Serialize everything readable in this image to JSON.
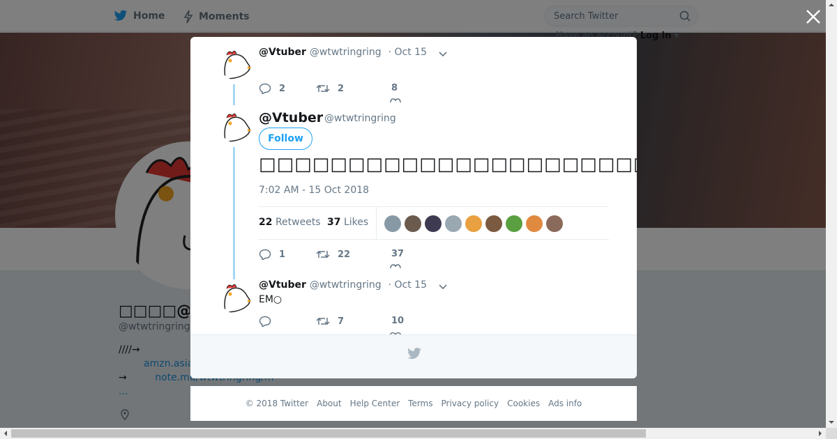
{
  "nav": {
    "home": "Home",
    "moments": "Moments"
  },
  "search": {
    "placeholder": "Search Twitter"
  },
  "signup": {
    "prompt": "Have an account?",
    "login": "Log in"
  },
  "profile": {
    "name": "□□□□@Vtuber",
    "handle": "@wtwtringring",
    "bio_line1": "////→",
    "bio_link1": "amzn.asia",
    "bio_line2_prefix": "→",
    "bio_link2": "note.mu/wtwtringring/m",
    "bio_more": "..."
  },
  "thread": {
    "tweet1": {
      "name": "@Vtuber",
      "handle": "@wtwtringring",
      "time": "· Oct 15",
      "replies": "2",
      "retweets": "2",
      "likes": "8"
    },
    "main": {
      "name": "@Vtuber",
      "handle": "@wtwtringring",
      "follow": "Follow",
      "text": "□□□□□□□□□□□□□□□□□□□□□□□□□□□□□□□□□□□□□□□□□□□□□□□□□□",
      "date": "7:02 AM - 15 Oct 2018",
      "retweets_count": "22",
      "retweets_label": "Retweets",
      "likes_count": "37",
      "likes_label": "Likes",
      "replies": "1",
      "retweets": "22",
      "likes": "37"
    },
    "tweet3": {
      "name": "@Vtuber",
      "handle": "@wtwtringring",
      "time": "· Oct 15",
      "text": "EM○",
      "retweets": "7",
      "likes": "10"
    }
  },
  "footer": {
    "copyright": "© 2018 Twitter",
    "about": "About",
    "help": "Help Center",
    "terms": "Terms",
    "privacy": "Privacy policy",
    "cookies": "Cookies",
    "ads": "Ads info"
  },
  "colors": {
    "accent": "#1da1f2",
    "thread_line": "#a5d7f5",
    "overlay": "rgba(0,0,0,0.5)",
    "likers": [
      "#8899a6",
      "#6b5b4f",
      "#3d3a52",
      "#9aa8b2",
      "#e8a040",
      "#7a5a40",
      "#5aa040",
      "#e08a40",
      "#8a6a5a"
    ]
  }
}
